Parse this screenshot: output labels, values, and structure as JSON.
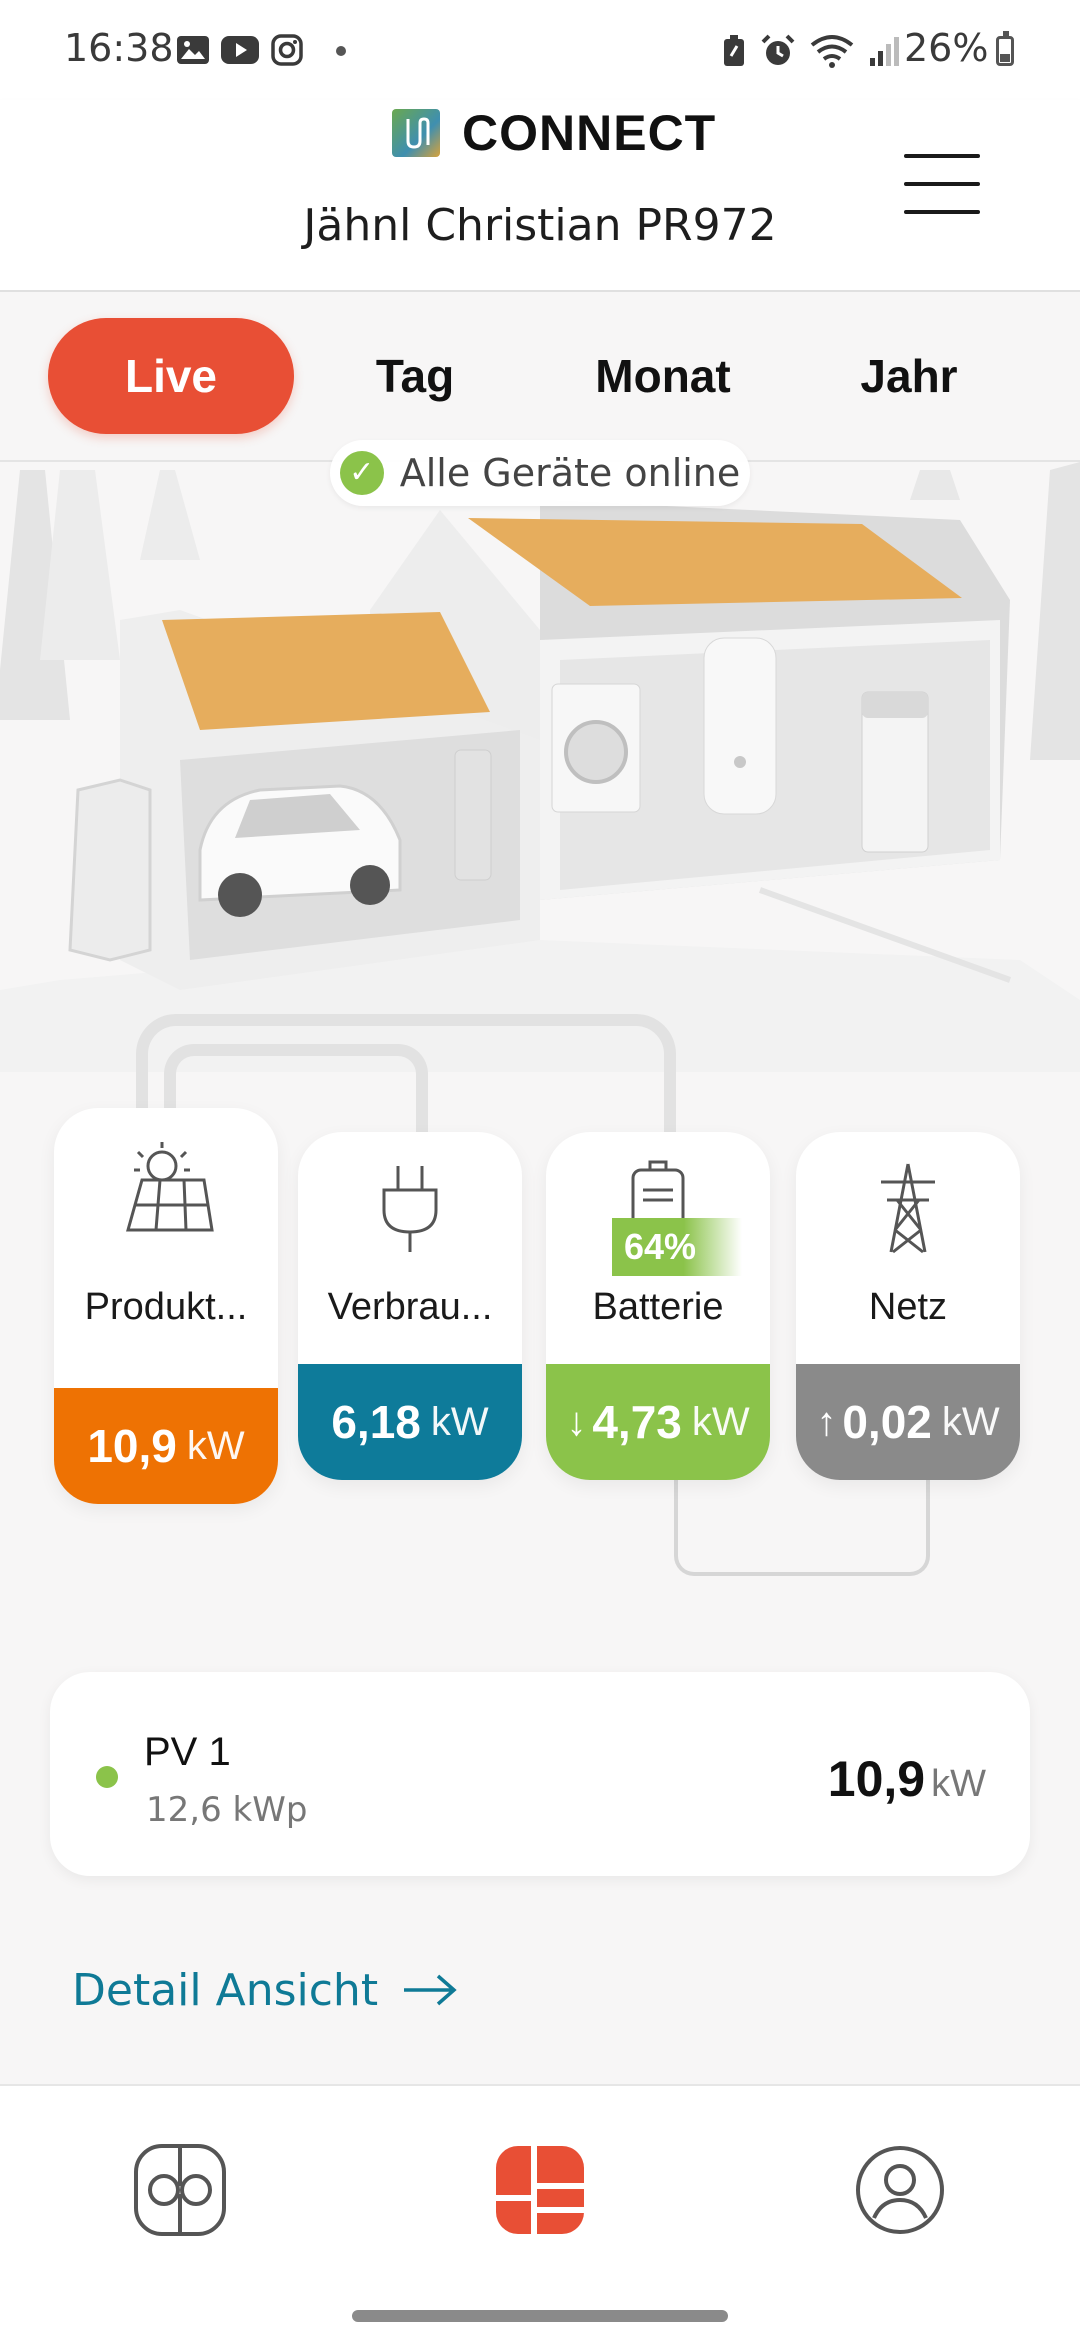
{
  "status_bar": {
    "time": "16:38",
    "battery_percent": "26%"
  },
  "header": {
    "brand": "CONNECT",
    "plant_name": "Jähnl Christian PR972"
  },
  "tabs": [
    {
      "label": "Live",
      "active": true
    },
    {
      "label": "Tag",
      "active": false
    },
    {
      "label": "Monat",
      "active": false
    },
    {
      "label": "Jahr",
      "active": false
    }
  ],
  "scene": {
    "online_status": "Alle Geräte online"
  },
  "cards": {
    "produktion": {
      "title": "Produkt...",
      "value": "10,9",
      "unit": "kW",
      "color": "#ee7203",
      "icon": "solar-panel-icon"
    },
    "verbrauch": {
      "title": "Verbrau...",
      "value": "6,18",
      "unit": "kW",
      "color": "#0e7b9a",
      "icon": "plug-icon"
    },
    "batterie": {
      "title": "Batterie",
      "value": "4,73",
      "unit": "kW",
      "soc": "64%",
      "arrow": "↓",
      "color": "#8bc34a",
      "icon": "battery-icon"
    },
    "netz": {
      "title": "Netz",
      "value": "0,02",
      "unit": "kW",
      "arrow": "↑",
      "color": "#8a8a8a",
      "icon": "power-tower-icon"
    }
  },
  "pv": {
    "name": "PV 1",
    "capacity": "12,6 kWp",
    "value": "10,9",
    "unit": "kW"
  },
  "detail_link": {
    "label": "Detail Ansicht"
  },
  "bottom_nav": {
    "items": [
      "overview-icon",
      "dashboard-icon",
      "profile-icon"
    ],
    "active_index": 1,
    "accent": "#e84f35"
  }
}
